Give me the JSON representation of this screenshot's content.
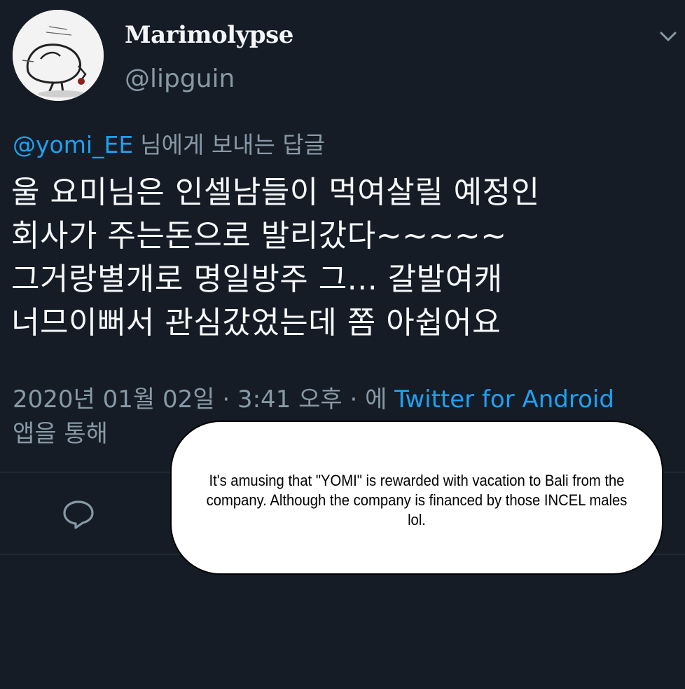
{
  "tweet": {
    "display_name": "Marimolypse",
    "handle": "@lipguin",
    "reply_to": {
      "mention": "@yomi_EE",
      "suffix": "님에게 보내는 답글"
    },
    "body_lines": [
      "울 요미님은 인셀남들이 먹여살릴 예정인",
      "회사가 주는돈으로 발리갔다~~~~~",
      "그거랑별개로 명일방주 그... 갈발여캐",
      "너므이뻐서 관심갔었는데 쫌 아쉽어요"
    ],
    "meta": {
      "datetime": "2020년 01월 02일 · 3:41 오후 · 에 ",
      "source": "Twitter for Android",
      "suffix": "앱을 통해"
    }
  },
  "caption": {
    "text": "It's amusing that \"YOMI\" is rewarded with vacation to Bali from the company. Although the company is financed by those INCEL males lol."
  },
  "icons": {
    "caret": "chevron-down-icon",
    "reply": "reply-icon",
    "avatar": "avatar-drawing"
  },
  "colors": {
    "background": "#151c26",
    "link": "#1da1f2",
    "muted": "#8899a6",
    "text": "#f5f7f9"
  }
}
